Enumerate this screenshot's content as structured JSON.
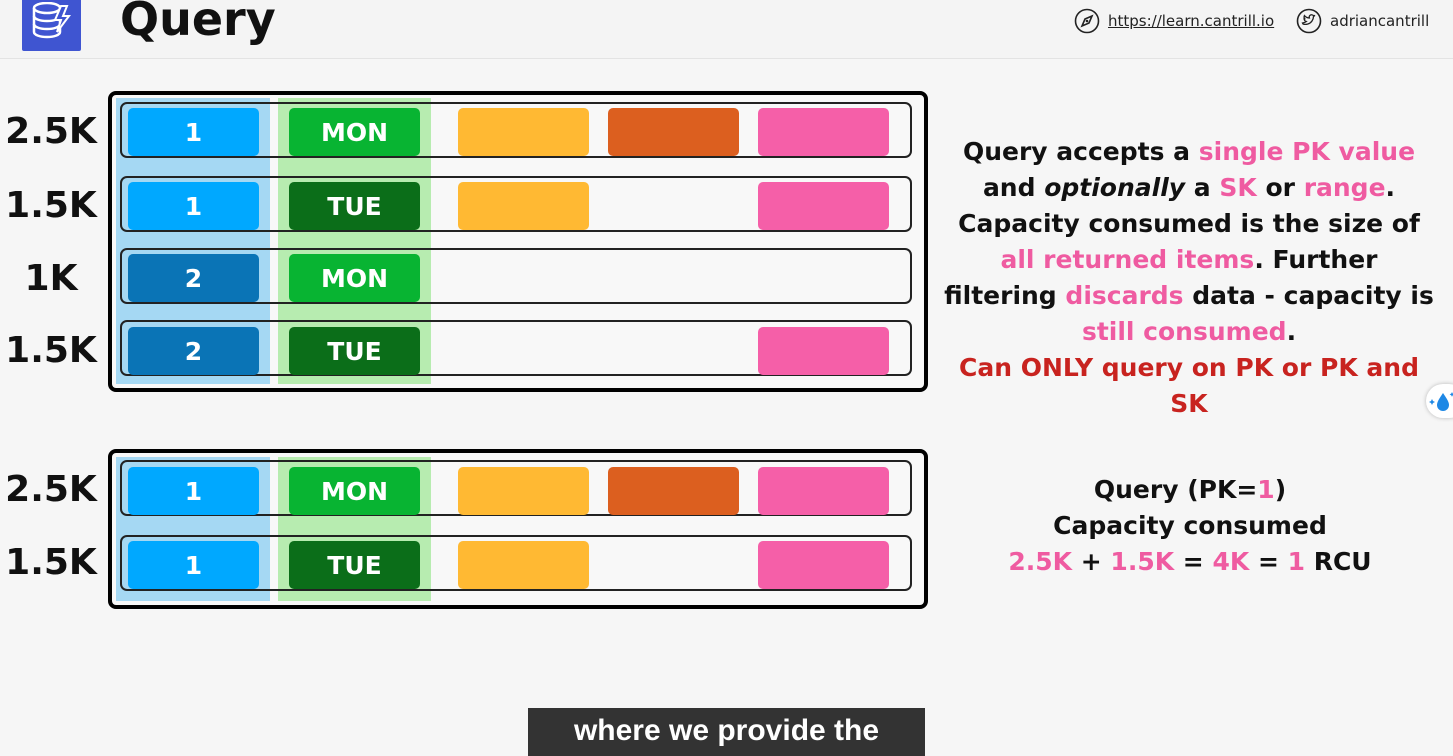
{
  "header": {
    "title": "Query",
    "website": "https://learn.cantrill.io",
    "twitter": "adriancantrill"
  },
  "colors": {
    "pk_light": "#00a8ff",
    "pk_dark": "#0a74b6",
    "sk_light": "#08b432",
    "sk_dark": "#0b6e19",
    "attr_yellow": "#ffb933",
    "attr_orange": "#dc5f1f",
    "attr_pink": "#f55fa8",
    "highlight": "#ef5ba1",
    "warning": "#c8231f"
  },
  "table1": {
    "rows": [
      {
        "size": "2.5K",
        "pk": "1",
        "sk": "MON"
      },
      {
        "size": "1.5K",
        "pk": "1",
        "sk": "TUE"
      },
      {
        "size": "1K",
        "pk": "2",
        "sk": "MON"
      },
      {
        "size": "1.5K",
        "pk": "2",
        "sk": "TUE"
      }
    ]
  },
  "table2": {
    "rows": [
      {
        "size": "2.5K",
        "pk": "1",
        "sk": "MON"
      },
      {
        "size": "1.5K",
        "pk": "1",
        "sk": "TUE"
      }
    ]
  },
  "explanation": {
    "t1": "Query accepts a ",
    "h1": "single PK value",
    "t2": " and ",
    "t3": "optionally",
    "t4": " a ",
    "h2": "SK",
    "t5": " or ",
    "h3": "range",
    "t6": ". Capacity consumed is the size of ",
    "h4": "all returned items",
    "t7": ". Further filtering ",
    "h5": "discards",
    "t8": " data - capacity is ",
    "h6": "still consumed",
    "t9": ".",
    "warning": "Can ONLY query on PK or PK and SK"
  },
  "summary": {
    "q_prefix": "Query (PK=",
    "q_value": "1",
    "q_suffix": ")",
    "line2": "Capacity consumed",
    "v1": "2.5K",
    "plus": " + ",
    "v2": "1.5K",
    "eq1": " = ",
    "v3": "4K",
    "eq2": " = ",
    "v4": "1",
    "unit": " RCU"
  },
  "caption": "where we provide the"
}
